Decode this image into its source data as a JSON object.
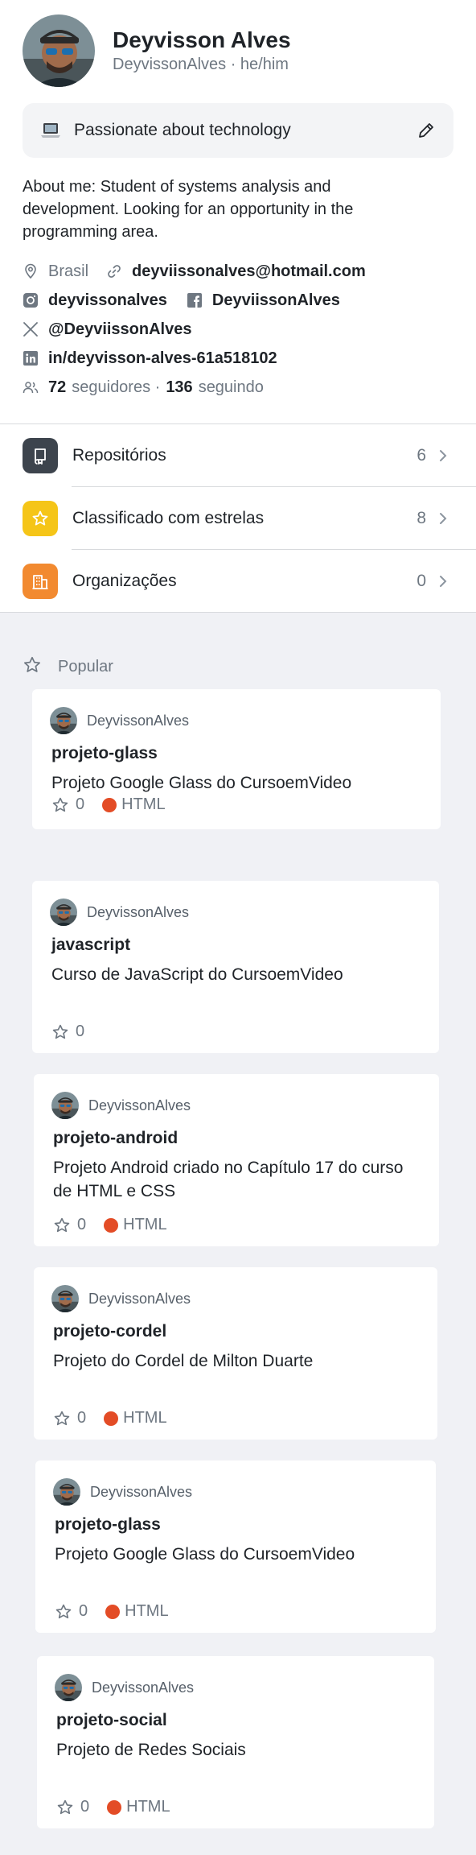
{
  "profile": {
    "full_name": "Deyvisson Alves",
    "handle_pronouns": "DeyvissonAlves · he/him",
    "status": {
      "emoji_icon": "laptop-icon",
      "text": "Passionate about technology"
    },
    "bio": "About me:  Student of systems analysis and development.  Looking for an opportunity in the programming area.",
    "location": "Brasil",
    "email": "deyviissonalves@hotmail.com",
    "instagram": "deyvissonalves",
    "facebook": "DeyviissonAlves",
    "x": "@DeyviissonAlves",
    "linkedin": "in/deyvisson-alves-61a518102",
    "followers_count": "72",
    "followers_label": "seguidores ·",
    "following_count": "136",
    "following_label": "seguindo"
  },
  "menu": [
    {
      "label": "Repositórios",
      "count": "6",
      "color": "#3d444d",
      "icon": "repo-icon"
    },
    {
      "label": "Classificado com estrelas",
      "count": "8",
      "color": "#f5c518",
      "icon": "star-icon"
    },
    {
      "label": "Organizações",
      "count": "0",
      "color": "#f28a30",
      "icon": "organization-icon"
    }
  ],
  "popular": {
    "label": "Popular",
    "cards": [
      {
        "owner": "DeyvissonAlves",
        "name": "projeto-glass",
        "description": "Projeto Google Glass do CursoemVideo",
        "stars": "0",
        "language": "HTML",
        "language_color": "#e34c26"
      },
      {
        "owner": "DeyvissonAlves",
        "name": "javascript",
        "description": "Curso de JavaScript do CursoemVideo",
        "stars": "0",
        "language": "",
        "language_color": ""
      },
      {
        "owner": "DeyvissonAlves",
        "name": "projeto-android",
        "description": "Projeto Android criado no Capítulo 17 do curso de HTML e CSS",
        "stars": "0",
        "language": "HTML",
        "language_color": "#e34c26"
      },
      {
        "owner": "DeyvissonAlves",
        "name": "projeto-cordel",
        "description": "Projeto do Cordel de Milton Duarte",
        "stars": "0",
        "language": "HTML",
        "language_color": "#e34c26"
      },
      {
        "owner": "DeyvissonAlves",
        "name": "projeto-glass",
        "description": "Projeto Google Glass do CursoemVideo",
        "stars": "0",
        "language": "HTML",
        "language_color": "#e34c26"
      },
      {
        "owner": "DeyvissonAlves",
        "name": "projeto-social",
        "description": "Projeto de Redes Sociais",
        "stars": "0",
        "language": "HTML",
        "language_color": "#e34c26"
      }
    ]
  }
}
